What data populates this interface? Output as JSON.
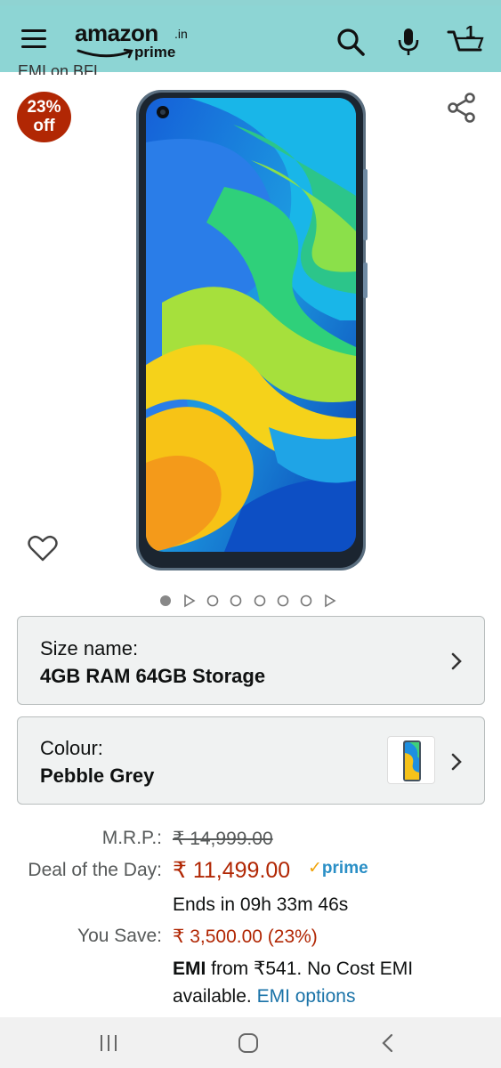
{
  "header": {
    "logo_text": "amazon",
    "logo_suffix": ".in",
    "logo_sub": "prime",
    "cart_count": "1"
  },
  "gallery": {
    "cut_off_text": "EMI on BFL",
    "discount_badge": {
      "percent": "23%",
      "word": "off"
    },
    "active_image_index": 0,
    "image_dots": [
      "dot",
      "video",
      "dot",
      "dot",
      "dot",
      "dot",
      "dot",
      "video"
    ]
  },
  "options": {
    "size": {
      "label": "Size name:",
      "value": "4GB RAM 64GB Storage"
    },
    "colour": {
      "label": "Colour:",
      "value": "Pebble Grey"
    }
  },
  "pricing": {
    "mrp_label": "M.R.P.:",
    "mrp_value": "₹ 14,999.00",
    "deal_label": "Deal of the Day:",
    "deal_value": "₹ 11,499.00",
    "prime_label": "prime",
    "ends_text": "Ends in 09h 33m 46s",
    "save_label": "You Save:",
    "save_value": "₹ 3,500.00 (23%)",
    "emi_bold": "EMI",
    "emi_text": " from ₹541. No Cost EMI available. ",
    "emi_link": "EMI options"
  },
  "colors": {
    "header_bg": "#8dd5d4",
    "price_red": "#b12704",
    "link_blue": "#1a73a8",
    "prime_blue": "#2a8fc6"
  },
  "icons": [
    "menu-icon",
    "search-icon",
    "mic-icon",
    "cart-icon",
    "share-icon",
    "heart-icon",
    "chevron-right-icon",
    "recent-apps-icon",
    "home-icon",
    "back-icon"
  ]
}
